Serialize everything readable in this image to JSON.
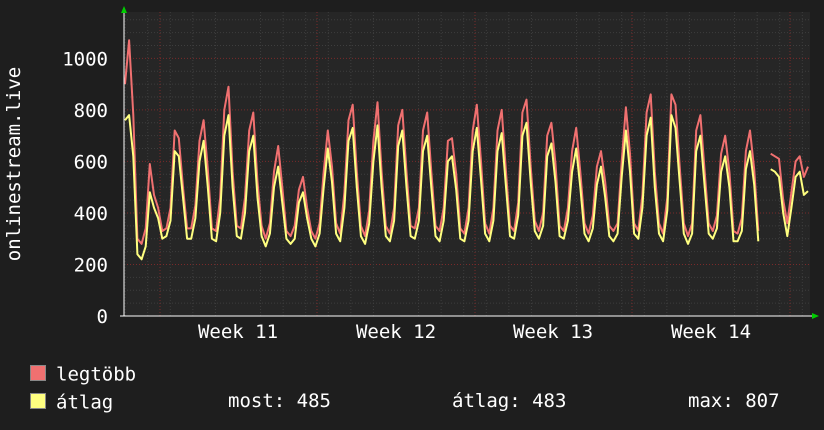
{
  "chart_data": {
    "type": "line",
    "ylabel": "onlinestream.live",
    "yticks": [
      0,
      200,
      400,
      600,
      800,
      1000
    ],
    "ylim": [
      0,
      1180
    ],
    "x_tick_labels": [
      "Week 11",
      "Week 12",
      "Week 13",
      "Week 14"
    ],
    "grid": true,
    "series": [
      {
        "name": "legtöbb",
        "color": "#f07070",
        "values": [
          900,
          1070,
          780,
          300,
          280,
          340,
          590,
          470,
          420,
          330,
          340,
          420,
          720,
          690,
          500,
          340,
          340,
          430,
          680,
          760,
          570,
          340,
          330,
          460,
          800,
          890,
          560,
          350,
          340,
          460,
          720,
          790,
          520,
          350,
          300,
          360,
          560,
          660,
          500,
          330,
          310,
          350,
          490,
          540,
          420,
          330,
          300,
          360,
          560,
          720,
          580,
          360,
          320,
          480,
          760,
          820,
          560,
          350,
          310,
          410,
          680,
          830,
          560,
          350,
          320,
          420,
          740,
          800,
          560,
          350,
          340,
          420,
          720,
          790,
          560,
          350,
          330,
          420,
          680,
          690,
          550,
          340,
          320,
          420,
          720,
          820,
          600,
          360,
          320,
          420,
          720,
          800,
          570,
          350,
          330,
          440,
          790,
          840,
          580,
          370,
          330,
          400,
          700,
          750,
          590,
          350,
          330,
          420,
          640,
          730,
          560,
          360,
          320,
          390,
          580,
          640,
          520,
          350,
          330,
          360,
          600,
          810,
          630,
          360,
          330,
          470,
          790,
          860,
          560,
          360,
          320,
          460,
          860,
          820,
          580,
          360,
          310,
          360,
          720,
          780,
          570,
          360,
          330,
          390,
          630,
          700,
          560,
          330,
          320,
          380,
          640,
          720,
          570,
          330,
          null,
          null,
          630,
          620,
          610,
          450,
          360,
          480,
          600,
          620,
          540,
          580
        ]
      },
      {
        "name": "átlag",
        "color": "#ffff80",
        "values": [
          760,
          780,
          620,
          240,
          220,
          270,
          480,
          420,
          380,
          300,
          310,
          370,
          640,
          620,
          460,
          300,
          300,
          380,
          600,
          680,
          500,
          300,
          290,
          400,
          700,
          780,
          500,
          310,
          300,
          400,
          640,
          700,
          460,
          310,
          270,
          320,
          500,
          580,
          440,
          300,
          280,
          300,
          440,
          480,
          380,
          300,
          270,
          320,
          500,
          650,
          520,
          320,
          290,
          420,
          680,
          730,
          500,
          310,
          280,
          360,
          600,
          740,
          500,
          310,
          290,
          370,
          660,
          720,
          500,
          310,
          300,
          370,
          640,
          700,
          500,
          310,
          290,
          370,
          600,
          620,
          490,
          300,
          290,
          370,
          640,
          730,
          530,
          320,
          290,
          370,
          640,
          710,
          510,
          310,
          300,
          390,
          700,
          750,
          520,
          330,
          300,
          350,
          620,
          670,
          520,
          310,
          300,
          370,
          560,
          650,
          500,
          320,
          290,
          340,
          510,
          580,
          460,
          310,
          290,
          320,
          540,
          720,
          560,
          320,
          300,
          420,
          700,
          770,
          500,
          320,
          290,
          410,
          780,
          730,
          520,
          320,
          280,
          320,
          640,
          700,
          510,
          320,
          300,
          340,
          560,
          620,
          500,
          290,
          290,
          330,
          570,
          640,
          510,
          290,
          null,
          null,
          570,
          560,
          540,
          400,
          310,
          420,
          540,
          560,
          470,
          485
        ]
      }
    ]
  },
  "legend": {
    "max_label": "legtöbb",
    "avg_label": "átlag"
  },
  "stats": {
    "now": "most: 485",
    "avg": "átlag: 483",
    "max": "max: 807"
  }
}
